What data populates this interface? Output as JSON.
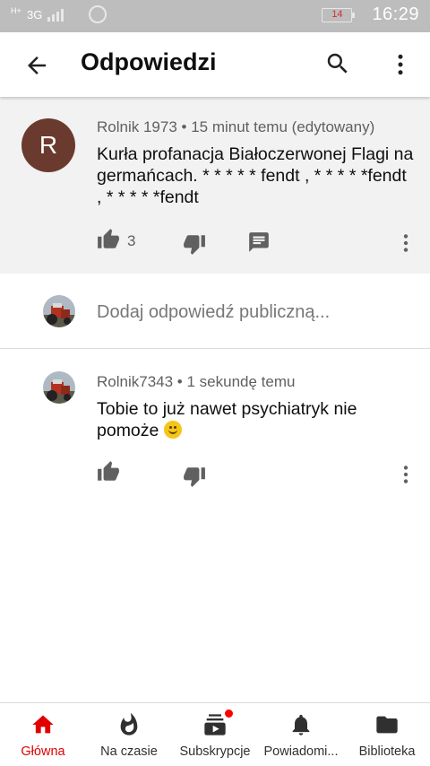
{
  "status_bar": {
    "network_type": "3G",
    "network_hplus": "H+",
    "battery": "14",
    "time": "16:29"
  },
  "app_bar": {
    "title": "Odpowiedzi"
  },
  "main_comment": {
    "avatar_letter": "R",
    "author": "Rolnik 1973",
    "separator": "•",
    "time": "15 minut temu (edytowany)",
    "text": "Kurła profanacja Białoczerwonej Flagi na germańcach. * * * * * fendt , * * * * *fendt , * * * * *fendt",
    "like_count": "3"
  },
  "add_reply": {
    "placeholder": "Dodaj odpowiedź publiczną..."
  },
  "reply_comment": {
    "author": "Rolnik7343",
    "separator": "•",
    "time": "1 sekundę temu",
    "text": "Tobie to już nawet psychiatryk nie pomoże"
  },
  "bottom_nav": {
    "items": [
      {
        "label": "Główna",
        "icon": "home-icon",
        "active": true
      },
      {
        "label": "Na czasie",
        "icon": "trending-icon",
        "active": false
      },
      {
        "label": "Subskrypcje",
        "icon": "subscriptions-icon",
        "active": false
      },
      {
        "label": "Powiadomi...",
        "icon": "notifications-icon",
        "active": false
      },
      {
        "label": "Biblioteka",
        "icon": "library-icon",
        "active": false
      }
    ]
  },
  "colors": {
    "accent": "#e00000",
    "avatar_bg": "#6b3a2e",
    "status_bar_bg": "#bdbdbd",
    "comment_highlight_bg": "#f2f2f2"
  }
}
